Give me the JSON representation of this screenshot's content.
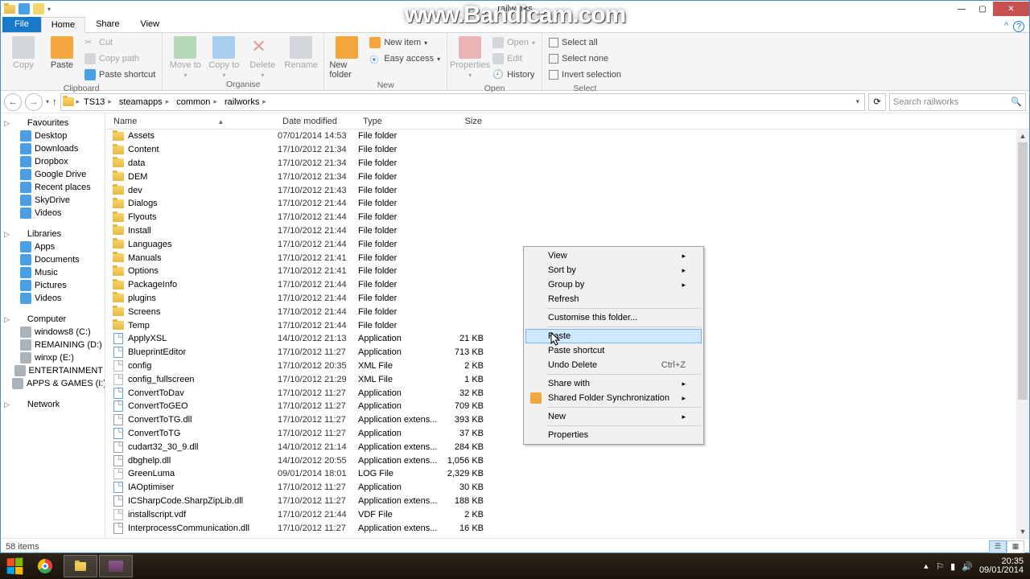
{
  "titlebar": {
    "title": "railworks"
  },
  "watermark": "www.Bandicam.com",
  "ribbon": {
    "tabs": {
      "file": "File",
      "home": "Home",
      "share": "Share",
      "view": "View"
    },
    "clipboard": {
      "copy": "Copy",
      "paste": "Paste",
      "cut": "Cut",
      "copy_path": "Copy path",
      "paste_shortcut": "Paste shortcut",
      "label": "Clipboard"
    },
    "organise": {
      "move_to": "Move to",
      "copy_to": "Copy to",
      "delete": "Delete",
      "rename": "Rename",
      "label": "Organise"
    },
    "new": {
      "new_folder": "New folder",
      "new_item": "New item",
      "easy_access": "Easy access",
      "label": "New"
    },
    "open": {
      "properties": "Properties",
      "open": "Open",
      "edit": "Edit",
      "history": "History",
      "label": "Open"
    },
    "select": {
      "select_all": "Select all",
      "select_none": "Select none",
      "invert": "Invert selection",
      "label": "Select"
    }
  },
  "breadcrumbs": [
    "TS13",
    "steamapps",
    "common",
    "railworks"
  ],
  "search": {
    "placeholder": "Search railworks"
  },
  "columns": {
    "name": "Name",
    "date": "Date modified",
    "type": "Type",
    "size": "Size"
  },
  "nav": {
    "favourites": "Favourites",
    "fav_items": [
      "Desktop",
      "Downloads",
      "Dropbox",
      "Google Drive",
      "Recent places",
      "SkyDrive",
      "Videos"
    ],
    "libraries": "Libraries",
    "lib_items": [
      "Apps",
      "Documents",
      "Music",
      "Pictures",
      "Videos"
    ],
    "computer": "Computer",
    "comp_items": [
      "windows8 (C:)",
      "REMAINING (D:)",
      "winxp (E:)",
      "ENTERTAINMENT",
      "APPS & GAMES (I:)"
    ],
    "network": "Network"
  },
  "files": [
    {
      "n": "Assets",
      "d": "07/01/2014 14:53",
      "t": "File folder",
      "s": "",
      "i": "folder"
    },
    {
      "n": "Content",
      "d": "17/10/2012 21:34",
      "t": "File folder",
      "s": "",
      "i": "folder"
    },
    {
      "n": "data",
      "d": "17/10/2012 21:34",
      "t": "File folder",
      "s": "",
      "i": "folder"
    },
    {
      "n": "DEM",
      "d": "17/10/2012 21:34",
      "t": "File folder",
      "s": "",
      "i": "folder"
    },
    {
      "n": "dev",
      "d": "17/10/2012 21:43",
      "t": "File folder",
      "s": "",
      "i": "folder"
    },
    {
      "n": "Dialogs",
      "d": "17/10/2012 21:44",
      "t": "File folder",
      "s": "",
      "i": "folder"
    },
    {
      "n": "Flyouts",
      "d": "17/10/2012 21:44",
      "t": "File folder",
      "s": "",
      "i": "folder"
    },
    {
      "n": "Install",
      "d": "17/10/2012 21:44",
      "t": "File folder",
      "s": "",
      "i": "folder"
    },
    {
      "n": "Languages",
      "d": "17/10/2012 21:44",
      "t": "File folder",
      "s": "",
      "i": "folder"
    },
    {
      "n": "Manuals",
      "d": "17/10/2012 21:41",
      "t": "File folder",
      "s": "",
      "i": "folder"
    },
    {
      "n": "Options",
      "d": "17/10/2012 21:41",
      "t": "File folder",
      "s": "",
      "i": "folder"
    },
    {
      "n": "PackageInfo",
      "d": "17/10/2012 21:44",
      "t": "File folder",
      "s": "",
      "i": "folder"
    },
    {
      "n": "plugins",
      "d": "17/10/2012 21:44",
      "t": "File folder",
      "s": "",
      "i": "folder"
    },
    {
      "n": "Screens",
      "d": "17/10/2012 21:44",
      "t": "File folder",
      "s": "",
      "i": "folder"
    },
    {
      "n": "Temp",
      "d": "17/10/2012 21:44",
      "t": "File folder",
      "s": "",
      "i": "folder"
    },
    {
      "n": "ApplyXSL",
      "d": "14/10/2012 21:13",
      "t": "Application",
      "s": "21 KB",
      "i": "app"
    },
    {
      "n": "BlueprintEditor",
      "d": "17/10/2012 11:27",
      "t": "Application",
      "s": "713 KB",
      "i": "app"
    },
    {
      "n": "config",
      "d": "17/10/2012 20:35",
      "t": "XML File",
      "s": "2 KB",
      "i": "file"
    },
    {
      "n": "config_fullscreen",
      "d": "17/10/2012 21:29",
      "t": "XML File",
      "s": "1 KB",
      "i": "file"
    },
    {
      "n": "ConvertToDav",
      "d": "17/10/2012 11:27",
      "t": "Application",
      "s": "32 KB",
      "i": "app"
    },
    {
      "n": "ConvertToGEO",
      "d": "17/10/2012 11:27",
      "t": "Application",
      "s": "709 KB",
      "i": "app"
    },
    {
      "n": "ConvertToTG.dll",
      "d": "17/10/2012 11:27",
      "t": "Application extens...",
      "s": "393 KB",
      "i": "dll"
    },
    {
      "n": "ConvertToTG",
      "d": "17/10/2012 11:27",
      "t": "Application",
      "s": "37 KB",
      "i": "app"
    },
    {
      "n": "cudart32_30_9.dll",
      "d": "14/10/2012 21:14",
      "t": "Application extens...",
      "s": "284 KB",
      "i": "dll"
    },
    {
      "n": "dbghelp.dll",
      "d": "14/10/2012 20:55",
      "t": "Application extens...",
      "s": "1,056 KB",
      "i": "dll"
    },
    {
      "n": "GreenLuma",
      "d": "09/01/2014 18:01",
      "t": "LOG File",
      "s": "2,329 KB",
      "i": "file"
    },
    {
      "n": "IAOptimiser",
      "d": "17/10/2012 11:27",
      "t": "Application",
      "s": "30 KB",
      "i": "app"
    },
    {
      "n": "ICSharpCode.SharpZipLib.dll",
      "d": "17/10/2012 11:27",
      "t": "Application extens...",
      "s": "188 KB",
      "i": "dll"
    },
    {
      "n": "installscript.vdf",
      "d": "17/10/2012 21:44",
      "t": "VDF File",
      "s": "2 KB",
      "i": "file"
    },
    {
      "n": "InterprocessCommunication.dll",
      "d": "17/10/2012 11:27",
      "t": "Application extens...",
      "s": "16 KB",
      "i": "dll"
    }
  ],
  "context_menu": {
    "view": "View",
    "sort_by": "Sort by",
    "group_by": "Group by",
    "refresh": "Refresh",
    "customise": "Customise this folder...",
    "paste": "Paste",
    "paste_shortcut": "Paste shortcut",
    "undo_delete": "Undo Delete",
    "undo_sc": "Ctrl+Z",
    "share_with": "Share with",
    "shared_sync": "Shared Folder Synchronization",
    "new": "New",
    "properties": "Properties"
  },
  "status": {
    "item_count": "58 items"
  },
  "tray": {
    "time": "20:35",
    "date": "09/01/2014"
  }
}
